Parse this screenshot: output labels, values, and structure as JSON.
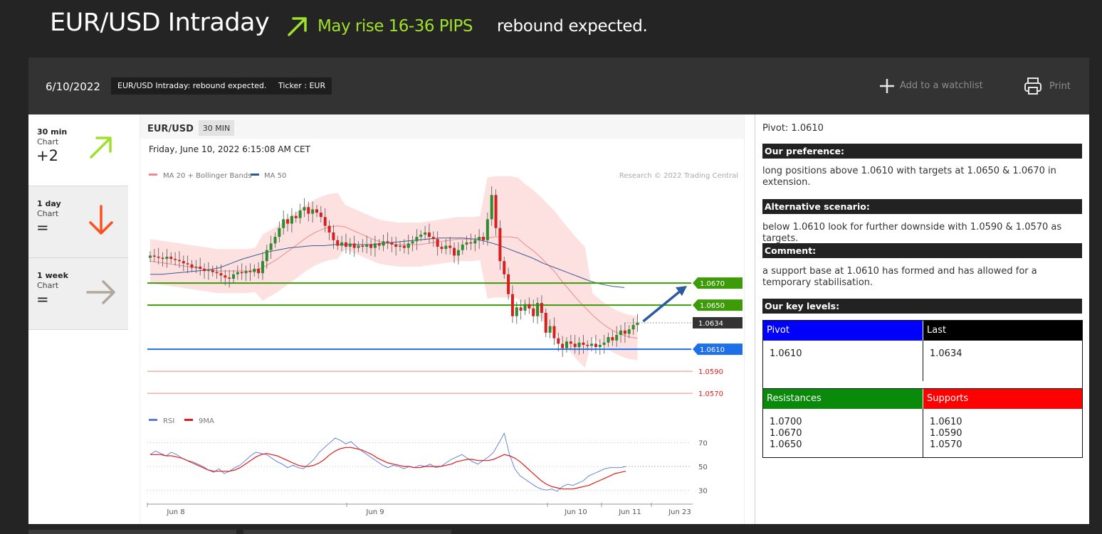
{
  "header": {
    "title": "EUR/USD Intraday",
    "forecast": "May rise 16-36 PIPS",
    "subtitle": "rebound expected."
  },
  "toolbar": {
    "date": "6/10/2022",
    "headline_chip": "EUR/USD Intraday: rebound expected.",
    "ticker_chip": "Ticker : EUR",
    "watchlist_label": "Add to a watchlist",
    "print_label": "Print"
  },
  "timeframes": [
    {
      "name": "30 min",
      "sub": "Chart",
      "score": "+2",
      "direction": "up",
      "color": "#9fe02c"
    },
    {
      "name": "1 day",
      "sub": "Chart",
      "score": "=",
      "direction": "down",
      "color": "#ff4e1f"
    },
    {
      "name": "1 week",
      "sub": "Chart",
      "score": "=",
      "direction": "right",
      "color": "#b0a89a"
    }
  ],
  "chart": {
    "symbol": "EUR/USD",
    "interval": "30 MIN",
    "timestamp": "Friday, June 10, 2022 6:15:08 AM CET",
    "copyright": "Research © 2022 Trading Central",
    "legend": [
      {
        "name": "MA 20 + Bollinger Bands",
        "color": "#ef8b8b"
      },
      {
        "name": "MA 50",
        "color": "#2f5a8f"
      }
    ],
    "rsi_legend": [
      {
        "name": "RSI",
        "color": "#5a7ad8"
      },
      {
        "name": "9MA",
        "color": "#e11b1b"
      }
    ],
    "x_labels": [
      "Jun 8",
      "Jun 9",
      "Jun 10",
      "Jun 11",
      "Jun 23"
    ],
    "rsi_ticks": [
      "70",
      "50",
      "30"
    ]
  },
  "chart_data": {
    "type": "candlestick",
    "levels": [
      {
        "label": "1.0670",
        "value": 1.067,
        "kind": "resistance",
        "color": "#3d9b0a"
      },
      {
        "label": "1.0650",
        "value": 1.065,
        "kind": "resistance",
        "color": "#3d9b0a"
      },
      {
        "label": "1.0634",
        "value": 1.0634,
        "kind": "last",
        "color": "#333333"
      },
      {
        "label": "1.0610",
        "value": 1.061,
        "kind": "pivot",
        "color": "#1e6fe8"
      },
      {
        "label": "1.0590",
        "value": 1.059,
        "kind": "support",
        "color": "#e02020"
      },
      {
        "label": "1.0570",
        "value": 1.057,
        "kind": "support",
        "color": "#e02020"
      }
    ],
    "close": [
      1.0695,
      1.0694,
      1.0693,
      1.0692,
      1.0694,
      1.0692,
      1.0691,
      1.069,
      1.0688,
      1.0687,
      1.0684,
      1.0685,
      1.0683,
      1.0681,
      1.0682,
      1.068,
      1.0679,
      1.0677,
      1.0675,
      1.0674,
      1.0678,
      1.068,
      1.0679,
      1.0681,
      1.068,
      1.0683,
      1.0679,
      1.069,
      1.07,
      1.0706,
      1.0712,
      1.072,
      1.0728,
      1.0724,
      1.0731,
      1.0729,
      1.0736,
      1.0739,
      1.0733,
      1.0737,
      1.0734,
      1.073,
      1.0722,
      1.0716,
      1.0709,
      1.0704,
      1.0707,
      1.0703,
      1.0706,
      1.0702,
      1.0704,
      1.0703,
      1.0705,
      1.0702,
      1.0706,
      1.0704,
      1.0708,
      1.0707,
      1.0705,
      1.0703,
      1.0704,
      1.0702,
      1.0706,
      1.0708,
      1.0712,
      1.0714,
      1.0716,
      1.0712,
      1.071,
      1.0703,
      1.0701,
      1.0704,
      1.0702,
      1.0695,
      1.07,
      1.0705,
      1.0707,
      1.0706,
      1.0709,
      1.0712,
      1.0709,
      1.0728,
      1.075,
      1.072,
      1.069,
      1.0678,
      1.066,
      1.064,
      1.0648,
      1.0645,
      1.0651,
      1.0647,
      1.064,
      1.0652,
      1.0643,
      1.0625,
      1.0631,
      1.062,
      1.0615,
      1.0611,
      1.0617,
      1.0615,
      1.0612,
      1.0616,
      1.0614,
      1.0613,
      1.0615,
      1.0612,
      1.0614,
      1.0616,
      1.0621,
      1.0618,
      1.0623,
      1.0627,
      1.0624,
      1.0628,
      1.0632,
      1.0634
    ],
    "ma20": [
      1.069,
      1.0689,
      1.0688,
      1.0687,
      1.0686,
      1.0685,
      1.0684,
      1.0683,
      1.0682,
      1.0681,
      1.0681,
      1.0681,
      1.0681,
      1.0681,
      1.0682,
      1.0684,
      1.0688,
      1.0692,
      1.0697,
      1.0702,
      1.0707,
      1.0712,
      1.0716,
      1.0719,
      1.0721,
      1.0722,
      1.0721,
      1.0718,
      1.0715,
      1.0712,
      1.0709,
      1.0707,
      1.0706,
      1.0705,
      1.0705,
      1.0705,
      1.0705,
      1.0706,
      1.0707,
      1.0708,
      1.0709,
      1.071,
      1.071,
      1.071,
      1.0711,
      1.0711,
      1.0712,
      1.0712,
      1.0712,
      1.0711,
      1.0705,
      1.07,
      1.0694,
      1.0687,
      1.068,
      1.0671,
      1.0663,
      1.0655,
      1.0648,
      1.0641,
      1.0635,
      1.063,
      1.0626,
      1.0623,
      1.0621,
      1.062
    ],
    "ma50": [
      1.0678,
      1.0678,
      1.0679,
      1.068,
      1.0681,
      1.0682,
      1.0684,
      1.0688,
      1.0692,
      1.0695,
      1.0698,
      1.07,
      1.0702,
      1.0703,
      1.0704,
      1.0704,
      1.0705,
      1.0705,
      1.0705,
      1.0705,
      1.0706,
      1.0707,
      1.0708,
      1.0709,
      1.071,
      1.0711,
      1.0711,
      1.0711,
      1.071,
      1.0708,
      1.0705,
      1.0701,
      1.0697,
      1.0693,
      1.0688,
      1.0684,
      1.068,
      1.0676,
      1.0672,
      1.0669,
      1.0667,
      1.0666
    ],
    "rsi": [
      60,
      63,
      61,
      59,
      62,
      60,
      57,
      55,
      54,
      52,
      50,
      47,
      45,
      48,
      44,
      46,
      49,
      51,
      55,
      59,
      62,
      61,
      60,
      57,
      54,
      52,
      49,
      51,
      49,
      48,
      52,
      56,
      62,
      66,
      70,
      74,
      72,
      69,
      71,
      67,
      63,
      60,
      57,
      54,
      51,
      49,
      51,
      50,
      48,
      50,
      49,
      51,
      50,
      52,
      49,
      50,
      53,
      56,
      58,
      60,
      57,
      54,
      52,
      55,
      58,
      62,
      70,
      78,
      60,
      48,
      42,
      39,
      36,
      33,
      31,
      30,
      31,
      29,
      33,
      35,
      34,
      36,
      38,
      42,
      44,
      46,
      48,
      49,
      49,
      49,
      50
    ],
    "rsi_ma": [
      60,
      60,
      60,
      59,
      59,
      58,
      57,
      55,
      53,
      51,
      49,
      47,
      46,
      46,
      46,
      46,
      47,
      49,
      52,
      55,
      58,
      60,
      61,
      60,
      59,
      57,
      55,
      53,
      51,
      50,
      50,
      51,
      53,
      56,
      60,
      63,
      65,
      66,
      66,
      65,
      64,
      62,
      60,
      57,
      55,
      53,
      52,
      51,
      50,
      50,
      49,
      49,
      50,
      50,
      50,
      50,
      51,
      52,
      54,
      55,
      56,
      56,
      55,
      55,
      55,
      56,
      58,
      60,
      59,
      57,
      54,
      50,
      46,
      42,
      38,
      35,
      33,
      32,
      31,
      31,
      31,
      32,
      33,
      34,
      36,
      38,
      40,
      42,
      44,
      45,
      46
    ],
    "y_range": [
      1.0552,
      1.0765
    ],
    "rsi_range": [
      20,
      80
    ]
  },
  "sidebar": {
    "pivot_line": "Pivot: 1.0610",
    "preference_title": "Our preference:",
    "preference_text": "long positions above 1.0610 with targets at 1.0650 & 1.0670 in extension.",
    "alternative_title": "Alternative scenario:",
    "alternative_text": "below 1.0610 look for further downside with 1.0590 & 1.0570 as targets.",
    "comment_title": "Comment:",
    "comment_text": "a support base at 1.0610 has formed and has allowed for a temporary stabilisation.",
    "key_levels_title": "Our key levels:",
    "pivot_label": "Pivot",
    "pivot_value": "1.0610",
    "last_label": "Last",
    "last_value": "1.0634",
    "resistances_label": "Resistances",
    "resistances": [
      "1.0700",
      "1.0670",
      "1.0650"
    ],
    "supports_label": "Supports",
    "supports": [
      "1.0610",
      "1.0590",
      "1.0570"
    ],
    "colors": {
      "pivot": "#0000ff",
      "last": "#000000",
      "resistances": "#0a8a0a",
      "supports": "#ff0000"
    }
  }
}
